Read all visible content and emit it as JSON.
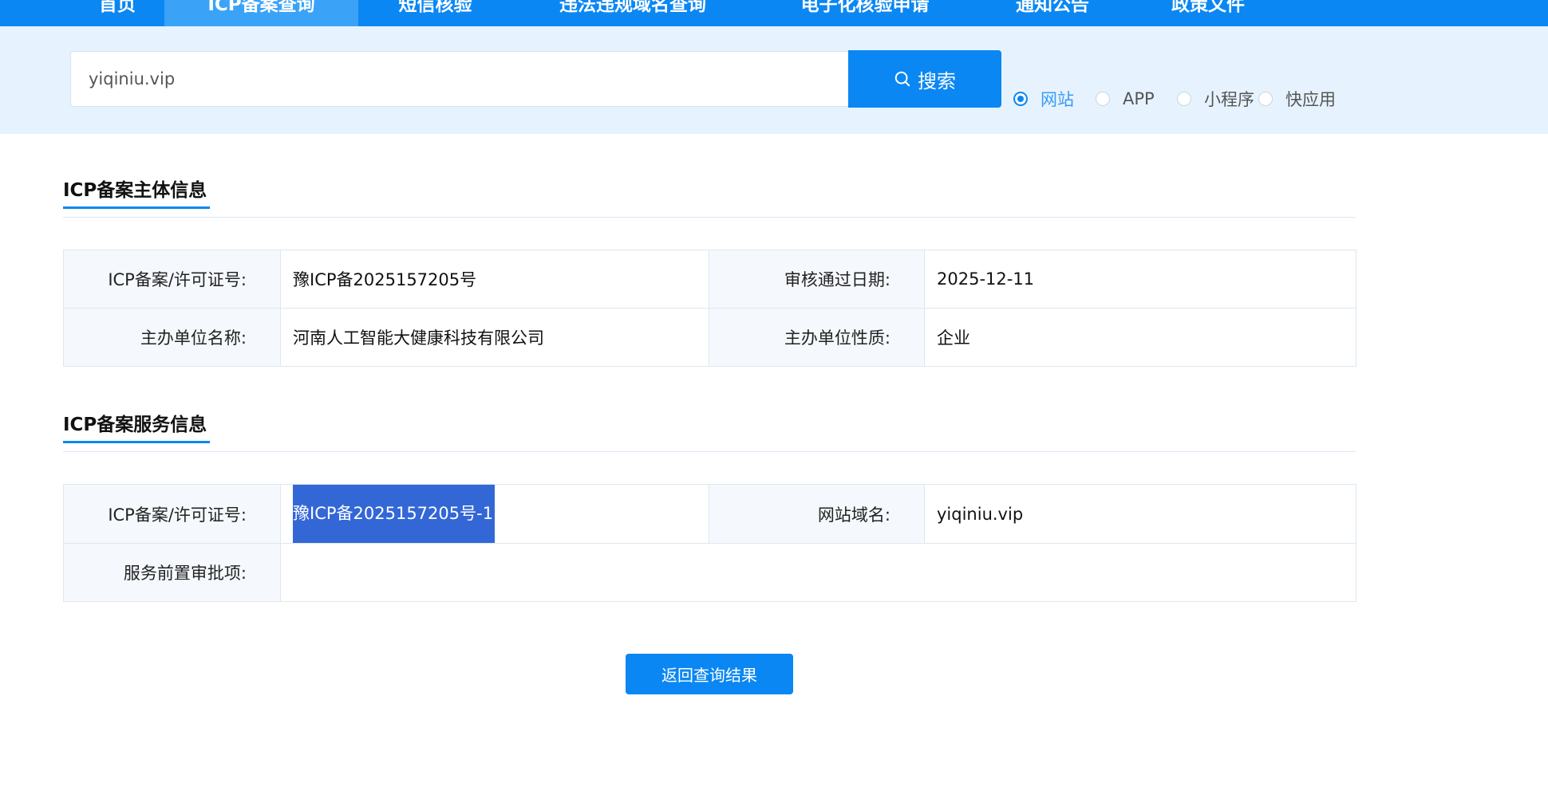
{
  "nav": {
    "items": [
      {
        "label": "首页",
        "active": false
      },
      {
        "label": "ICP备案查询",
        "active": true
      },
      {
        "label": "短信核验",
        "active": false
      },
      {
        "label": "违法违规域名查询",
        "active": false
      },
      {
        "label": "电子化核验申请",
        "active": false
      },
      {
        "label": "通知公告",
        "active": false
      },
      {
        "label": "政策文件",
        "active": false
      }
    ]
  },
  "search": {
    "value": "yiqiniu.vip",
    "button_label": "搜索",
    "options": [
      {
        "label": "网站",
        "checked": true
      },
      {
        "label": "APP",
        "checked": false
      },
      {
        "label": "小程序",
        "checked": false
      },
      {
        "label": "快应用",
        "checked": false
      }
    ]
  },
  "subject_section": {
    "title": "ICP备案主体信息",
    "license_label": "ICP备案/许可证号:",
    "license_value": "豫ICP备2025157205号",
    "approve_date_label": "审核通过日期:",
    "approve_date_value": "2025-12-11",
    "org_name_label": "主办单位名称:",
    "org_name_value": "河南人工智能大健康科技有限公司",
    "org_type_label": "主办单位性质:",
    "org_type_value": "企业"
  },
  "service_section": {
    "title": "ICP备案服务信息",
    "license_label": "ICP备案/许可证号:",
    "license_value": "豫ICP备2025157205号-1",
    "domain_label": "网站域名:",
    "domain_value": "yiqiniu.vip",
    "preapproval_label": "服务前置审批项:",
    "preapproval_value": ""
  },
  "actions": {
    "back_label": "返回查询结果"
  },
  "colors": {
    "primary": "#0a87f3",
    "band": "#e6f3fe",
    "selection": "#3367d6"
  }
}
